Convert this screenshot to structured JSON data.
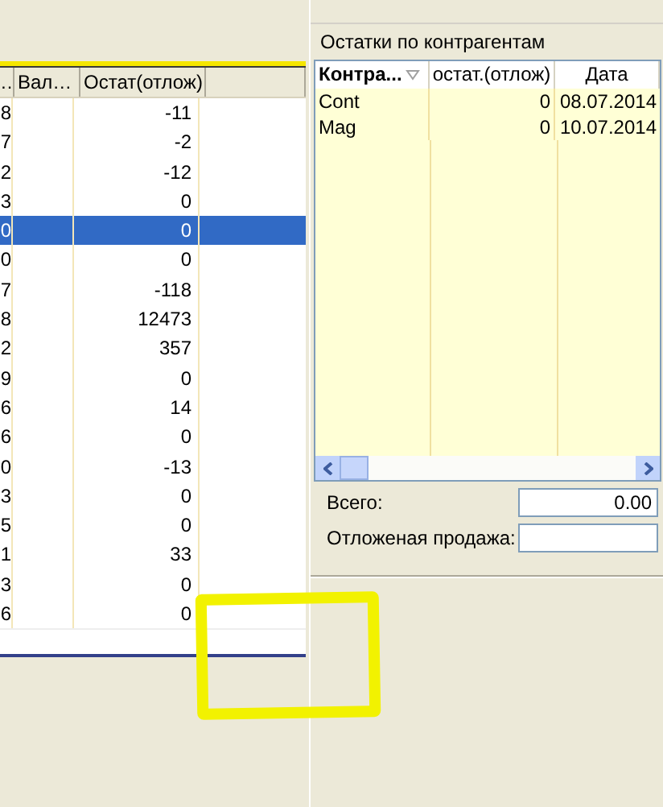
{
  "left_table": {
    "columns": [
      "…",
      "Вал…",
      "Остат(отлож)"
    ],
    "rows": [
      {
        "column_1": "8",
        "value": "-11",
        "selected": false
      },
      {
        "column_1": "7",
        "value": "-2",
        "selected": false
      },
      {
        "column_1": "2",
        "value": "-12",
        "selected": false
      },
      {
        "column_1": "3",
        "value": "0",
        "selected": false
      },
      {
        "column_1": "0",
        "value": "0",
        "selected": true
      },
      {
        "column_1": "0",
        "value": "0",
        "selected": false
      },
      {
        "column_1": "7",
        "value": "-118",
        "selected": false
      },
      {
        "column_1": "8",
        "value": "12473",
        "selected": false
      },
      {
        "column_1": "2",
        "value": "357",
        "selected": false
      },
      {
        "column_1": "9",
        "value": "0",
        "selected": false
      },
      {
        "column_1": "6",
        "value": "14",
        "selected": false
      },
      {
        "column_1": "6",
        "value": "0",
        "selected": false
      },
      {
        "column_1": "0",
        "value": "-13",
        "selected": false
      },
      {
        "column_1": "3",
        "value": "0",
        "selected": false
      },
      {
        "column_1": "5",
        "value": "0",
        "selected": false
      },
      {
        "column_1": "1",
        "value": "33",
        "selected": false
      },
      {
        "column_1": "3",
        "value": "0",
        "selected": false
      },
      {
        "column_1": "6",
        "value": "0",
        "selected": false
      }
    ]
  },
  "counterparty_panel": {
    "title": "Остатки по контрагентам",
    "columns": [
      "Контра...",
      "остат.(отлож)",
      "Дата"
    ],
    "rows": [
      {
        "name": "Cont",
        "balance": "0",
        "date": "08.07.2014"
      },
      {
        "name": "Mag",
        "balance": "0",
        "date": "10.07.2014"
      }
    ],
    "total_label": "Всего:",
    "total_value": "0.00",
    "deferred_label": "Отложеная продажа:"
  }
}
